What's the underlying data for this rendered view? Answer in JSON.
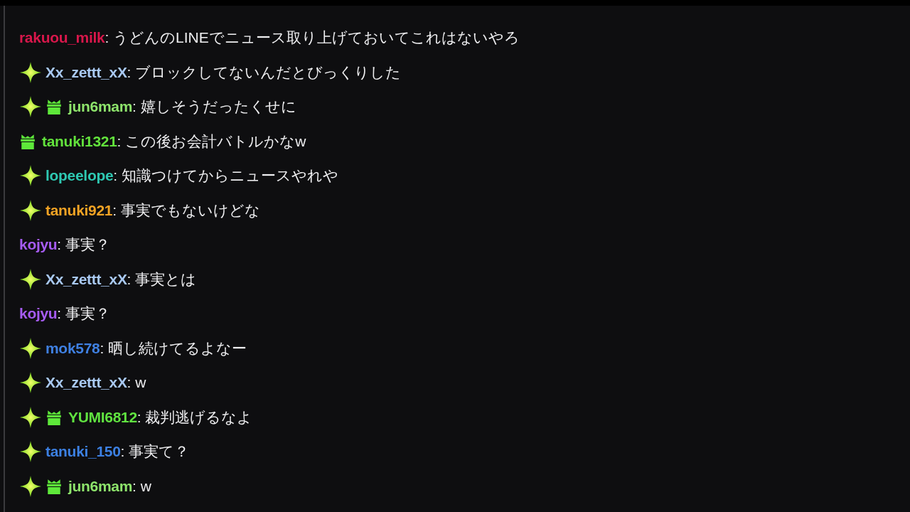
{
  "messages": [
    {
      "user": "rakuou_milk",
      "color": "#d8174b",
      "text": ": うどんのLINEでニュース取り上げておいてこれはないやろ"
    },
    {
      "badges": [
        {
          "kind": "star"
        }
      ],
      "user": "Xx_zettt_xX",
      "color": "#a9c9f2",
      "text": ": ブロックしてないんだとびっくりした"
    },
    {
      "badges": [
        {
          "kind": "star"
        },
        {
          "kind": "gift"
        }
      ],
      "user": "jun6mam",
      "color": "#8ee46c",
      "text": ": 嬉しそうだったくせに"
    },
    {
      "badges": [
        {
          "kind": "gift"
        }
      ],
      "user": "tanuki1321",
      "color": "#62e23c",
      "text": ": この後お会計バトルかなw"
    },
    {
      "badges": [
        {
          "kind": "star"
        }
      ],
      "user": "lopeelope",
      "color": "#2ec8b2",
      "text": ": 知識つけてからニュースやれや"
    },
    {
      "badges": [
        {
          "kind": "star"
        }
      ],
      "user": "tanuki921",
      "color": "#f2a324",
      "text": ": 事実でもないけどな"
    },
    {
      "user": "kojyu",
      "color": "#a65cf2",
      "text": ": 事実？"
    },
    {
      "badges": [
        {
          "kind": "star"
        }
      ],
      "user": "Xx_zettt_xX",
      "color": "#a9c9f2",
      "text": ": 事実とは"
    },
    {
      "user": "kojyu",
      "color": "#a65cf2",
      "text": ": 事実？"
    },
    {
      "badges": [
        {
          "kind": "star"
        }
      ],
      "user": "mok578",
      "color": "#3f80e2",
      "text": ": 晒し続けてるよなー"
    },
    {
      "badges": [
        {
          "kind": "star"
        }
      ],
      "user": "Xx_zettt_xX",
      "color": "#a9c9f2",
      "text": ": w"
    },
    {
      "badges": [
        {
          "kind": "star"
        },
        {
          "kind": "gift"
        }
      ],
      "user": "YUMI6812",
      "color": "#60e240",
      "text": ": 裁判逃げるなよ"
    },
    {
      "badges": [
        {
          "kind": "star"
        }
      ],
      "user": "tanuki_150",
      "color": "#3c80e2",
      "text": ": 事実て？"
    },
    {
      "badges": [
        {
          "kind": "star"
        },
        {
          "kind": "gift"
        }
      ],
      "user": "jun6mam",
      "color": "#8ee46c",
      "text": ": w"
    }
  ]
}
